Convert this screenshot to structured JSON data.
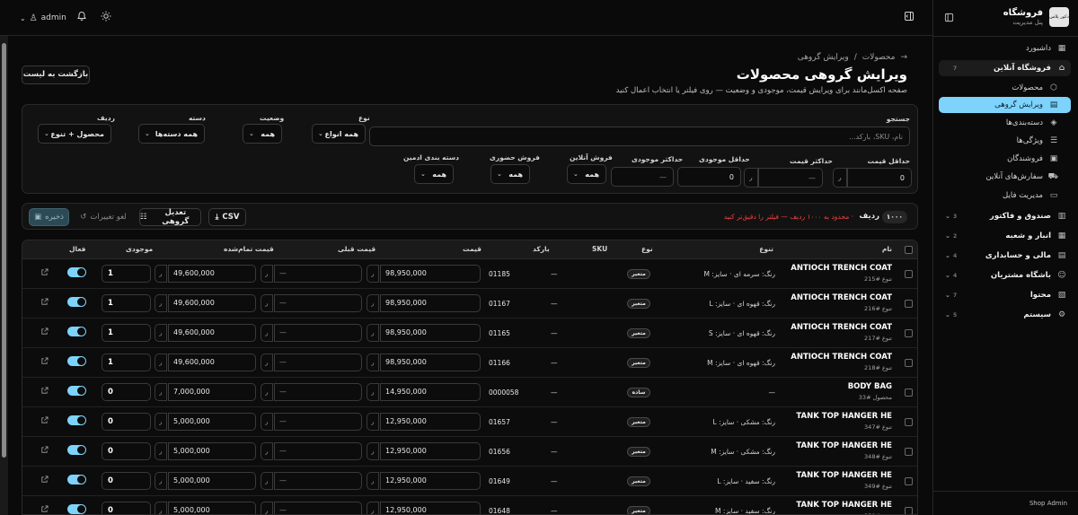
{
  "topbar": {
    "user_name": "admin",
    "icons": [
      "chevron-down-icon",
      "user-icon",
      "bell-icon",
      "sun-icon",
      "sidebar-toggle-icon"
    ]
  },
  "sidebar": {
    "brand_title": "فروشگاه",
    "brand_subtitle": "پنل مدیریت",
    "logo_text": "دکور پلاس",
    "items": [
      {
        "label": "داشبورد",
        "icon": "▦",
        "kind": "top"
      },
      {
        "label": "فروشگاه آنلاین",
        "icon": "⌂",
        "kind": "group-open",
        "count": "7"
      },
      {
        "label": "محصولات",
        "icon": "⬡",
        "kind": "sub"
      },
      {
        "label": "ویرایش گروهی",
        "icon": "▤",
        "kind": "sub-active"
      },
      {
        "label": "دسته‌بندی‌ها",
        "icon": "◈",
        "kind": "sub"
      },
      {
        "label": "ویژگی‌ها",
        "icon": "☰",
        "kind": "sub"
      },
      {
        "label": "فروشندگان",
        "icon": "▣",
        "kind": "sub"
      },
      {
        "label": "سفارش‌های آنلاین",
        "icon": "⛟",
        "kind": "sub"
      },
      {
        "label": "مدیریت فایل",
        "icon": "▭",
        "kind": "sub"
      },
      {
        "label": "صندوق و فاکتور",
        "icon": "▥",
        "kind": "group",
        "count": "3"
      },
      {
        "label": "انبار و شعبه",
        "icon": "▦",
        "kind": "group",
        "count": "2"
      },
      {
        "label": "مالی و حسابداری",
        "icon": "▤",
        "kind": "group",
        "count": "4"
      },
      {
        "label": "باشگاه مشتریان",
        "icon": "☺",
        "kind": "group",
        "count": "4"
      },
      {
        "label": "محتوا",
        "icon": "▧",
        "kind": "group",
        "count": "7"
      },
      {
        "label": "سیستم",
        "icon": "⚙",
        "kind": "group",
        "count": "5"
      }
    ],
    "footer": "Shop Admin"
  },
  "header": {
    "breadcrumb_parent": "محصولات",
    "breadcrumb_sep": "/",
    "breadcrumb_current": "ویرایش گروهی",
    "title": "ویرایش گروهی محصولات",
    "subtitle": "صفحه اکسل‌مانند برای ویرایش قیمت، موجودی و وضعیت — روی فیلتر یا انتخاب اعمال کنید",
    "back_button": "بازگشت به لیست"
  },
  "filters": {
    "search_label": "جستجو",
    "search_placeholder": "نام، SKU، بارکد...",
    "type_label": "نوع",
    "type_value": "همه انواع",
    "status_label": "وضعیت",
    "status_value": "همه",
    "category_label": "دسته",
    "category_value": "همه دسته‌ها",
    "row_label": "ردیف",
    "row_value": "محصول + تنوع",
    "min_price_label": "حداقل قیمت",
    "min_price_value": "0",
    "max_price_label": "حداکثر قیمت",
    "max_price_value": "—",
    "min_stock_label": "حداقل موجودی",
    "min_stock_value": "0",
    "max_stock_label": "حداکثر موجودی",
    "max_stock_value": "—",
    "online_label": "فروش آنلاین",
    "online_value": "همه",
    "inperson_label": "فروش حضوری",
    "inperson_value": "همه",
    "admincat_label": "دسته بندی ادمین",
    "admincat_value": "همه",
    "currency": "ر"
  },
  "toolbar": {
    "rows_count": "۱۰۰۰",
    "rows_label": "ردیف",
    "warning": "· محدود به ۱۰۰۰ ردیف — فیلتر را دقیق‌تر کنید",
    "csv": "CSV",
    "bulk": "تعدیل گروهی",
    "undo": "لغو تغییرات",
    "save": "ذخیره"
  },
  "table": {
    "headers": {
      "name": "نام",
      "variant": "تنوع",
      "type": "نوع",
      "sku": "SKU",
      "barcode": "بارکد",
      "price": "قیمت",
      "old_price": "قیمت قبلی",
      "cost": "قیمت تمام‌شده",
      "stock": "موجودی",
      "active": "فعال"
    },
    "currency": "ر",
    "rows": [
      {
        "name": "ANTIOCH TRENCH COAT",
        "sub": "تنوع #215",
        "variant": "رنگ: سرمه ای · سایز: M",
        "type": "متغیر",
        "sku": "—",
        "barcode": "01185",
        "price": "98,950,000",
        "old_price": "—",
        "cost": "49,600,000",
        "stock": "1",
        "active": true
      },
      {
        "name": "ANTIOCH TRENCH COAT",
        "sub": "تنوع #216",
        "variant": "رنگ: قهوه ای · سایز: L",
        "type": "متغیر",
        "sku": "—",
        "barcode": "01167",
        "price": "98,950,000",
        "old_price": "—",
        "cost": "49,600,000",
        "stock": "1",
        "active": true
      },
      {
        "name": "ANTIOCH TRENCH COAT",
        "sub": "تنوع #217",
        "variant": "رنگ: قهوه ای · سایز: S",
        "type": "متغیر",
        "sku": "—",
        "barcode": "01165",
        "price": "98,950,000",
        "old_price": "—",
        "cost": "49,600,000",
        "stock": "1",
        "active": true
      },
      {
        "name": "ANTIOCH TRENCH COAT",
        "sub": "تنوع #218",
        "variant": "رنگ: قهوه ای · سایز: M",
        "type": "متغیر",
        "sku": "—",
        "barcode": "01166",
        "price": "98,950,000",
        "old_price": "—",
        "cost": "49,600,000",
        "stock": "1",
        "active": true
      },
      {
        "name": "BODY BAG",
        "sub": "محصول #33",
        "variant": "—",
        "type": "ساده",
        "sku": "—",
        "barcode": "0000058",
        "price": "14,950,000",
        "old_price": "—",
        "cost": "7,000,000",
        "stock": "0",
        "active": true
      },
      {
        "name": "TANK TOP HANGER HE",
        "sub": "تنوع #347",
        "variant": "رنگ: مشکی · سایز: L",
        "type": "متغیر",
        "sku": "—",
        "barcode": "01657",
        "price": "12,950,000",
        "old_price": "—",
        "cost": "5,000,000",
        "stock": "0",
        "active": true
      },
      {
        "name": "TANK TOP HANGER HE",
        "sub": "تنوع #348",
        "variant": "رنگ: مشکی · سایز: M",
        "type": "متغیر",
        "sku": "—",
        "barcode": "01656",
        "price": "12,950,000",
        "old_price": "—",
        "cost": "5,000,000",
        "stock": "0",
        "active": true
      },
      {
        "name": "TANK TOP HANGER HE",
        "sub": "تنوع #349",
        "variant": "رنگ: سفید · سایز: L",
        "type": "متغیر",
        "sku": "—",
        "barcode": "01649",
        "price": "12,950,000",
        "old_price": "—",
        "cost": "5,000,000",
        "stock": "0",
        "active": true
      },
      {
        "name": "TANK TOP HANGER HE",
        "sub": "تنوع #350",
        "variant": "رنگ: سفید · سایز: M",
        "type": "متغیر",
        "sku": "—",
        "barcode": "01648",
        "price": "12,950,000",
        "old_price": "—",
        "cost": "5,000,000",
        "stock": "0",
        "active": true
      }
    ]
  },
  "colors": {
    "accent": "#7dd3fc",
    "warning": "#ef4444",
    "background": "#0a0a0a"
  }
}
